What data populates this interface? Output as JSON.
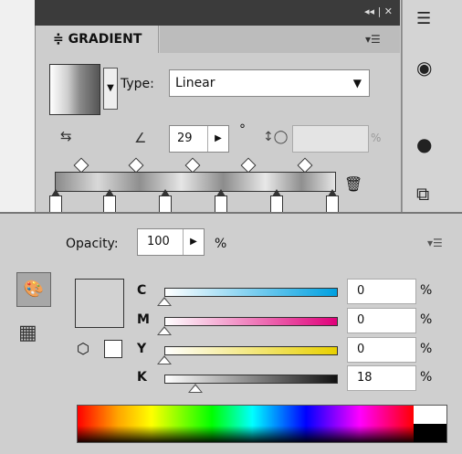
{
  "gradient_panel": {
    "title": "GRADIENT",
    "tab_marker": "≑",
    "type_label": "Type:",
    "type_value": "Linear",
    "angle_value": "29",
    "angle_unit": "°",
    "aspect_unit": "%"
  },
  "color_panel": {
    "opacity_label": "Opacity:",
    "opacity_value": "100",
    "opacity_unit": "%",
    "channels": [
      {
        "label": "C",
        "value": "0",
        "unit": "%",
        "thumb_fraction": 0.0,
        "colors": [
          "#ffffff",
          "#00a0e0"
        ]
      },
      {
        "label": "M",
        "value": "0",
        "unit": "%",
        "thumb_fraction": 0.0,
        "colors": [
          "#ffffff",
          "#e0007a"
        ]
      },
      {
        "label": "Y",
        "value": "0",
        "unit": "%",
        "thumb_fraction": 0.0,
        "colors": [
          "#ffffff",
          "#e8d000"
        ]
      },
      {
        "label": "K",
        "value": "18",
        "unit": "%",
        "thumb_fraction": 0.18,
        "colors": [
          "#ffffff",
          "#111111"
        ]
      }
    ]
  },
  "icons": {
    "menu": "menu-icon",
    "trash": "trash-icon",
    "reverse": "reverse-gradient-icon",
    "angle": "angle-icon",
    "aspect": "aspect-ratio-icon",
    "color_tool": "color-icon",
    "swatches": "swatches-grid-icon"
  }
}
